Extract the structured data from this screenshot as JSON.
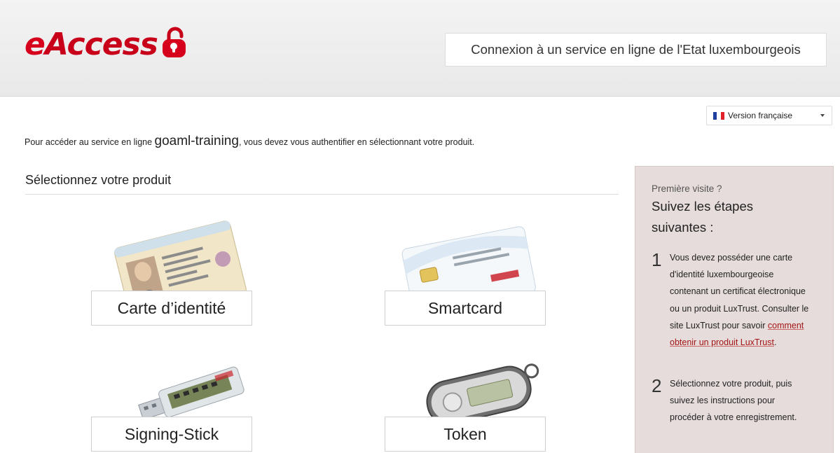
{
  "header": {
    "logo_text_e": "e",
    "logo_text_rest": "Access",
    "tagline": "Connexion à un service en ligne de l'Etat luxembourgeois"
  },
  "language": {
    "selected": "Version française",
    "flag_colors": [
      "#1f3f9e",
      "#ffffff",
      "#e1202a"
    ]
  },
  "intro": {
    "before": "Pour accéder au service en ligne ",
    "service": "goaml-training",
    "after": ", vous devez vous authentifier en sélectionnant votre produit."
  },
  "section_title": "Sélectionnez votre produit",
  "products": [
    {
      "label": "Carte d’identité",
      "icon": "id-card-image"
    },
    {
      "label": "Smartcard",
      "icon": "smartcard-image"
    },
    {
      "label": "Signing-Stick",
      "icon": "usb-stick-image"
    },
    {
      "label": "Token",
      "icon": "token-image"
    }
  ],
  "sidebar": {
    "first_visit": "Première visite ?",
    "heading": "Suivez les étapes suivantes :",
    "step1_num": "1",
    "step1_text": "Vous devez posséder une carte d'identité luxembourgeoise contenant un certificat électronique ou un produit LuxTrust. Consulter le site LuxTrust pour savoir ",
    "step1_link": "comment obtenir un produit LuxTrust",
    "step1_end": ".",
    "step2_num": "2",
    "step2_text": "Sélectionnez votre produit, puis suivez les instructions pour procéder à votre enregistrement."
  },
  "colors": {
    "brand_red": "#c8001a",
    "sidebar_bg": "#e6dcdb",
    "link": "#a31515"
  }
}
